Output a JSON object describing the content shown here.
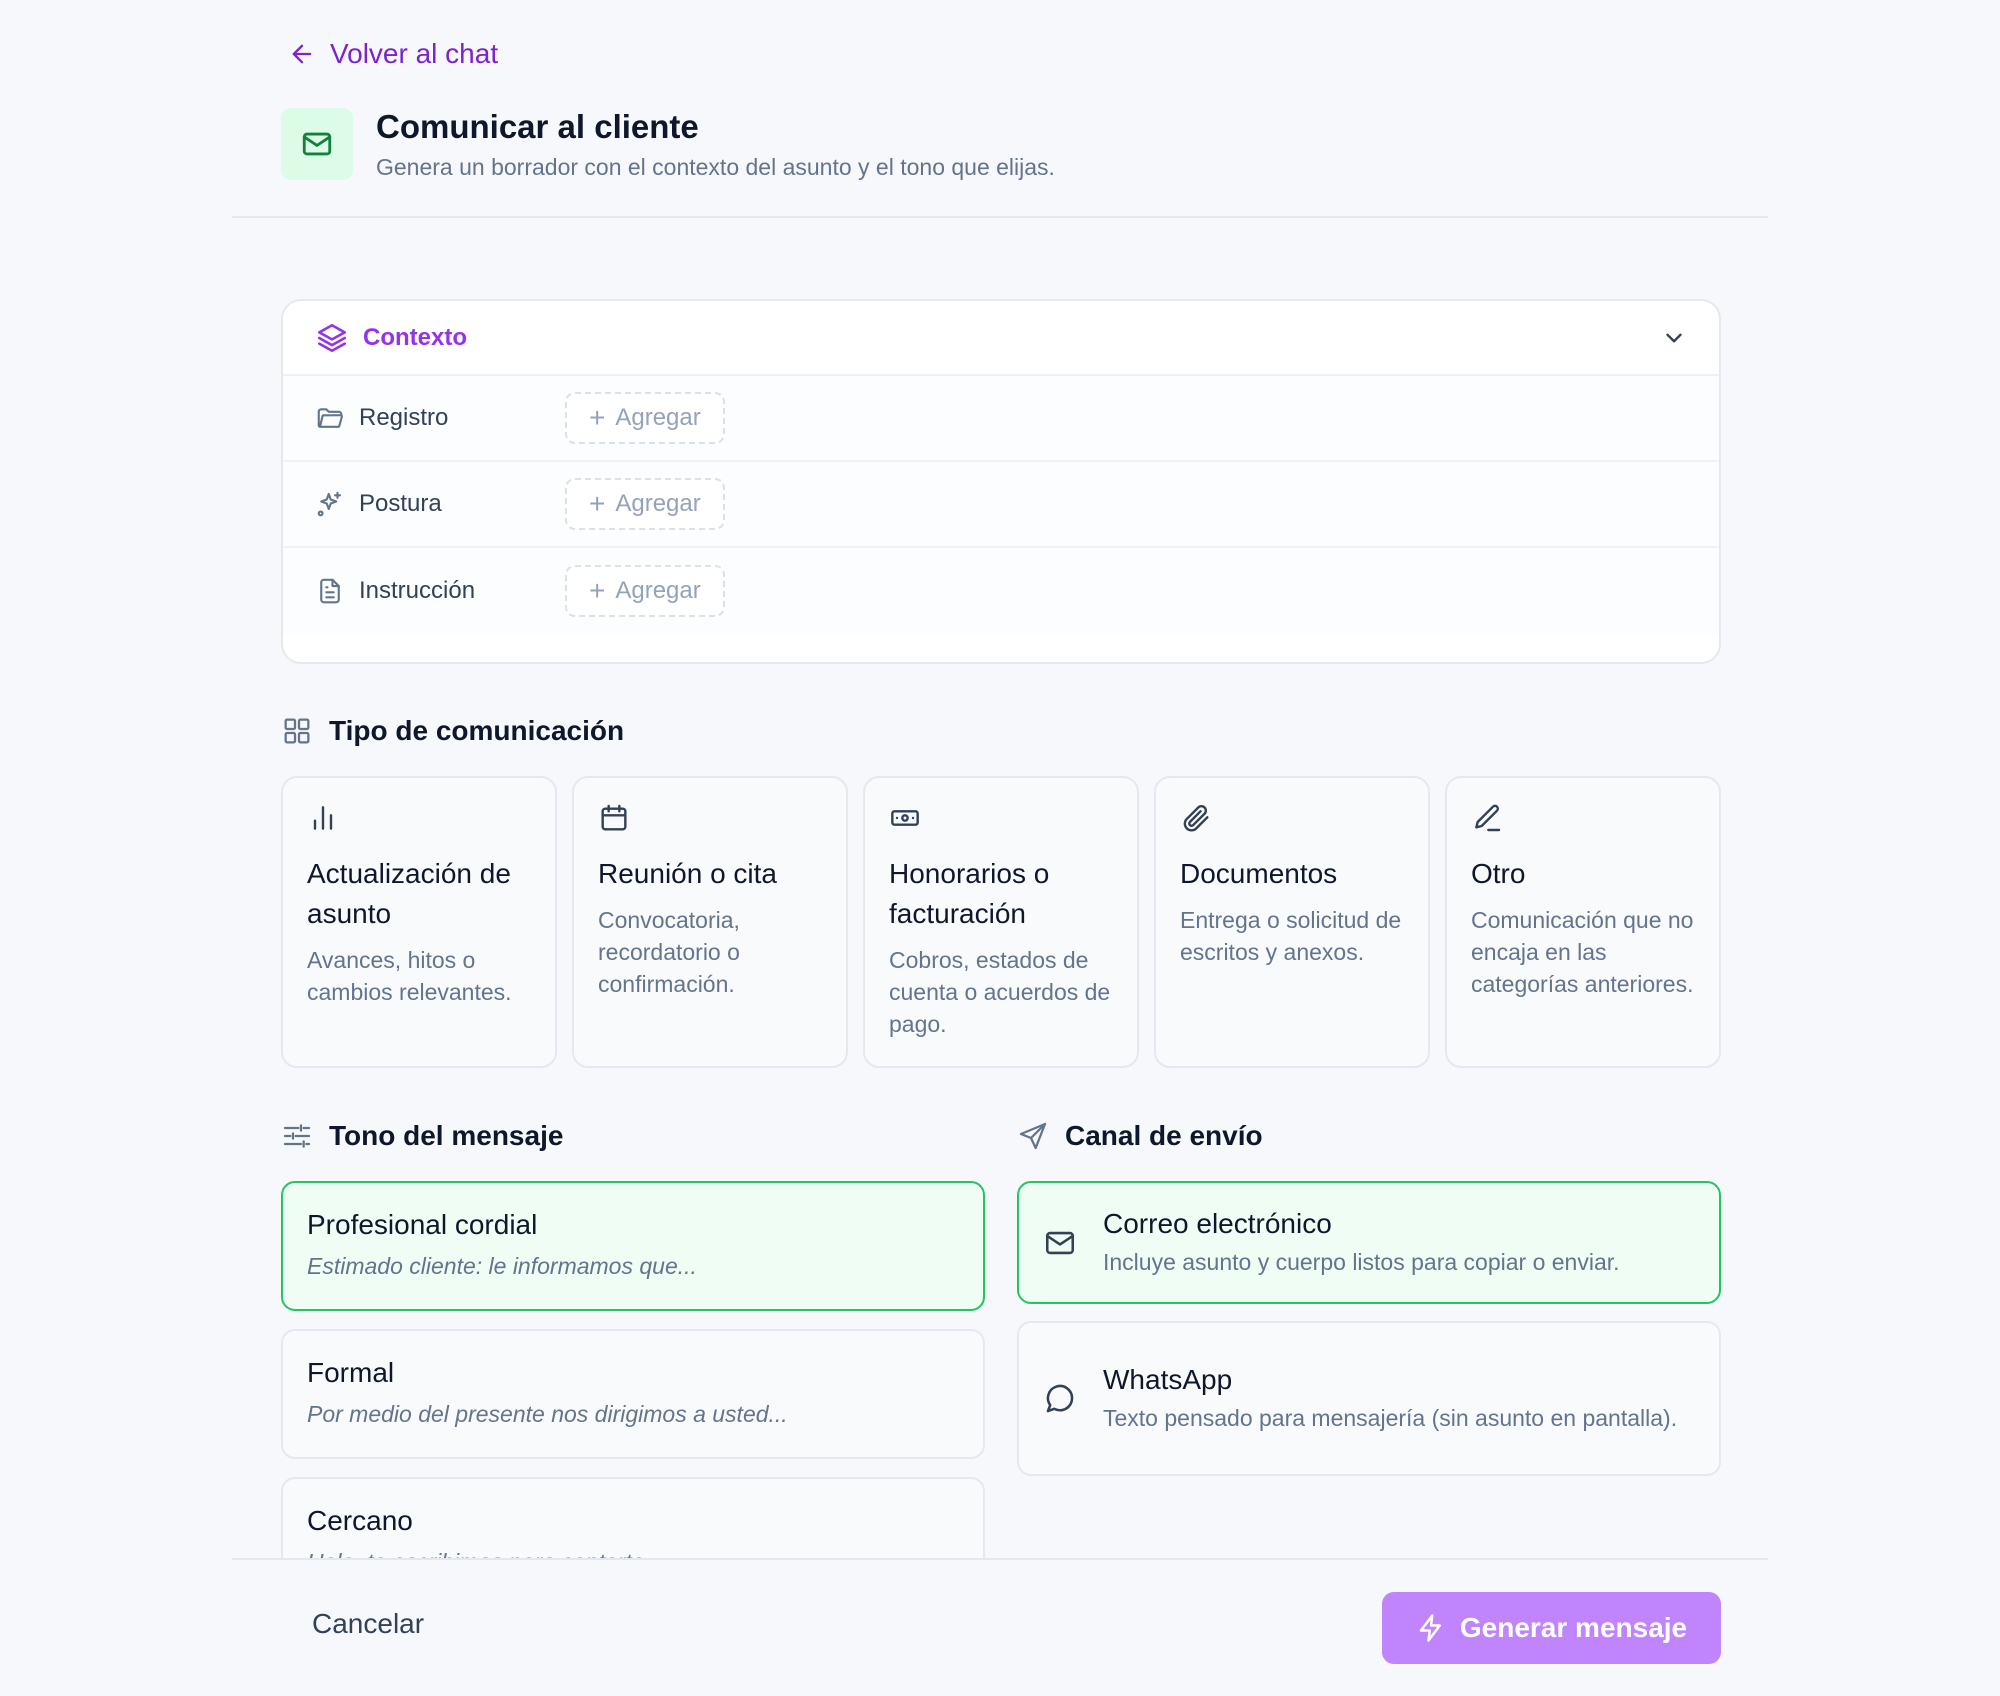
{
  "back_link": {
    "label": "Volver al chat"
  },
  "header": {
    "title": "Comunicar al cliente",
    "subtitle": "Genera un borrador con el contexto del asunto y el tono que elijas."
  },
  "context": {
    "label": "Contexto",
    "rows": [
      {
        "label": "Registro",
        "icon": "folder-icon",
        "add_label": "Agregar"
      },
      {
        "label": "Postura",
        "icon": "sparkles-icon",
        "add_label": "Agregar"
      },
      {
        "label": "Instrucción",
        "icon": "document-icon",
        "add_label": "Agregar"
      }
    ]
  },
  "comm_type": {
    "heading": "Tipo de comunicación",
    "cards": [
      {
        "title": "Actualización de asunto",
        "desc": "Avances, hitos o cambios relevantes.",
        "icon": "bar-chart-icon"
      },
      {
        "title": "Reunión o cita",
        "desc": "Convocatoria, recordatorio o confirmación.",
        "icon": "calendar-icon"
      },
      {
        "title": "Honorarios o facturación",
        "desc": "Cobros, estados de cuenta o acuerdos de pago.",
        "icon": "banknote-icon"
      },
      {
        "title": "Documentos",
        "desc": "Entrega o solicitud de escritos y anexos.",
        "icon": "paperclip-icon"
      },
      {
        "title": "Otro",
        "desc": "Comunicación que no encaja en las categorías anteriores.",
        "icon": "pencil-icon"
      }
    ]
  },
  "tone": {
    "heading": "Tono del mensaje",
    "options": [
      {
        "title": "Profesional cordial",
        "desc": "Estimado cliente: le informamos que...",
        "selected": true
      },
      {
        "title": "Formal",
        "desc": "Por medio del presente nos dirigimos a usted...",
        "selected": false
      },
      {
        "title": "Cercano",
        "desc": "Hola, te escribimos para contarte...",
        "selected": false
      }
    ]
  },
  "channel": {
    "heading": "Canal de envío",
    "options": [
      {
        "title": "Correo electrónico",
        "desc": "Incluye asunto y cuerpo listos para copiar o enviar.",
        "icon": "mail-icon",
        "selected": true
      },
      {
        "title": "WhatsApp",
        "desc": "Texto pensado para mensajería (sin asunto en pantalla).",
        "icon": "chat-bubble-icon",
        "selected": false
      }
    ]
  },
  "footer": {
    "cancel_label": "Cancelar",
    "generate_label": "Generar mensaje"
  },
  "colors": {
    "accent_purple": "#9333ea",
    "selected_green": "#22c55e",
    "generate_button": "#c084fc"
  }
}
